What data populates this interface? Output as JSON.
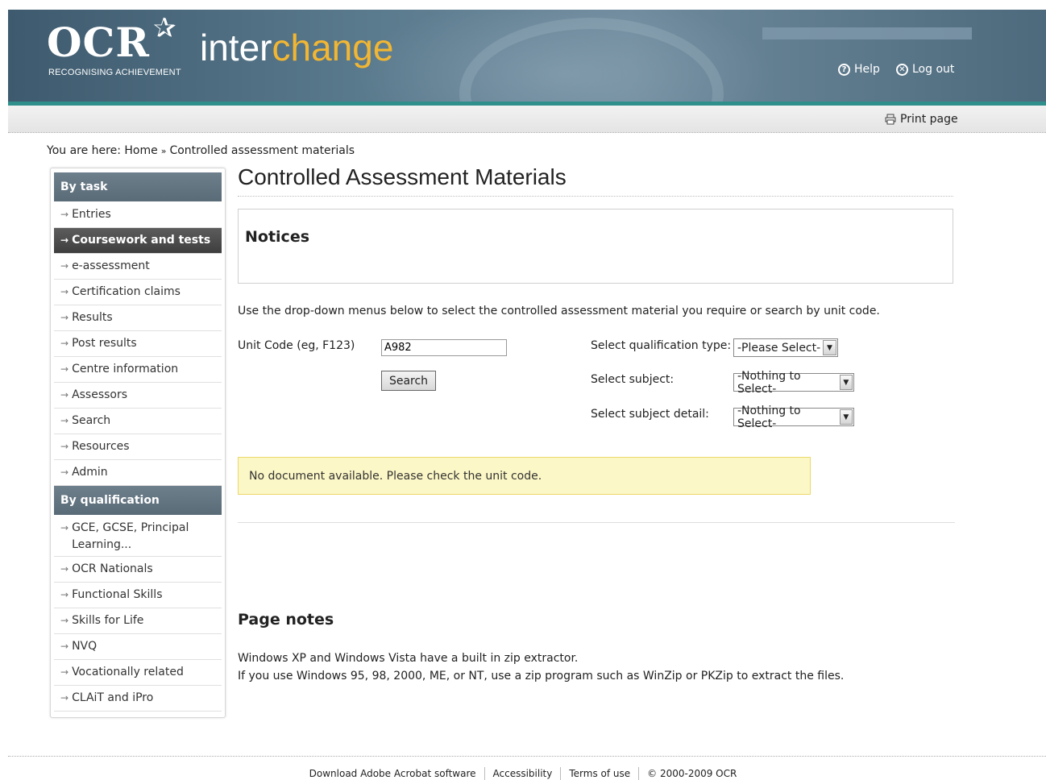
{
  "header": {
    "logo_text": "OCR",
    "logo_tagline": "RECOGNISING ACHIEVEMENT",
    "app_name_part1": "inter",
    "app_name_part2": "change",
    "help_label": "Help",
    "logout_label": "Log out",
    "print_label": "Print page",
    "colors": {
      "teal_bar": "#2f8f8b",
      "accent_orange": "#f2b632"
    }
  },
  "breadcrumb": {
    "prefix": "You are here:",
    "home": "Home",
    "separator": "»",
    "current": "Controlled assessment materials"
  },
  "sidebar": {
    "by_task_heading": "By task",
    "task_items": [
      {
        "label": "Entries"
      },
      {
        "label": "Coursework and tests",
        "active": true
      },
      {
        "label": "e-assessment"
      },
      {
        "label": "Certification claims"
      },
      {
        "label": "Results"
      },
      {
        "label": "Post results"
      },
      {
        "label": "Centre information"
      },
      {
        "label": "Assessors"
      },
      {
        "label": "Search"
      },
      {
        "label": "Resources"
      },
      {
        "label": "Admin"
      }
    ],
    "by_qualification_heading": "By qualification",
    "qualification_items": [
      {
        "label": "GCE, GCSE, Principal Learning..."
      },
      {
        "label": "OCR Nationals"
      },
      {
        "label": "Functional Skills"
      },
      {
        "label": "Skills for Life"
      },
      {
        "label": "NVQ"
      },
      {
        "label": "Vocationally related"
      },
      {
        "label": "CLAiT and iPro"
      }
    ]
  },
  "main": {
    "title": "Controlled Assessment Materials",
    "notices_title": "Notices",
    "instructions": "Use the drop-down menus below to select the controlled assessment material you require or search by unit code.",
    "unit_code_label": "Unit Code (eg, F123)",
    "unit_code_value": "A982",
    "search_label": "Search",
    "qualification_type_label": "Select qualification type:",
    "qualification_type_value": "-Please Select-",
    "subject_label": "Select subject:",
    "subject_value": "-Nothing to Select-",
    "subject_detail_label": "Select subject detail:",
    "subject_detail_value": "-Nothing to Select-",
    "message": "No document available. Please check the unit code.",
    "page_notes_title": "Page notes",
    "page_notes_line1": "Windows XP and Windows Vista have a built in zip extractor.",
    "page_notes_line2": "If you use Windows 95, 98, 2000, ME, or NT, use a zip program such as WinZip or PKZip to extract the files."
  },
  "footer": {
    "links": [
      "Download Adobe Acrobat software",
      "Accessibility",
      "Terms of use"
    ],
    "copyright": "© 2000-2009 OCR"
  }
}
